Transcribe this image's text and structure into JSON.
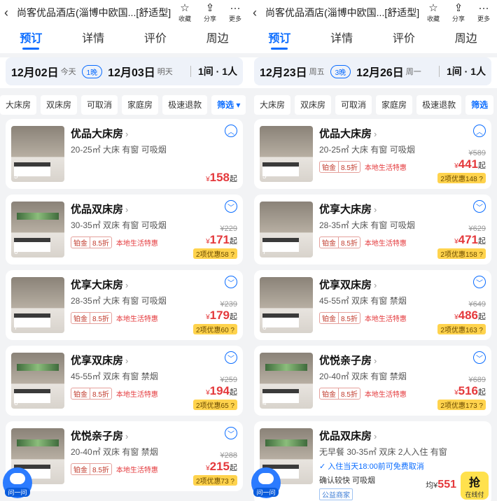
{
  "panels": [
    {
      "title": "尚客优品酒店(淄博中欧国...[舒适型]",
      "actions": [
        {
          "icon": "star-icon",
          "label": "收藏"
        },
        {
          "icon": "share-icon",
          "label": "分享"
        },
        {
          "icon": "more-icon",
          "label": "更多"
        }
      ],
      "tabs": [
        "预订",
        "详情",
        "评价",
        "周边"
      ],
      "dates": {
        "in": "12月02日",
        "in_sub": "今天",
        "nights": "1晚",
        "out": "12月03日",
        "out_sub": "明天",
        "rooms": "1间 · 1人"
      },
      "filters": [
        "大床房",
        "双床房",
        "可取消",
        "家庭房",
        "极速退款",
        "筛选 ▾"
      ],
      "rooms": [
        {
          "name": "优品大床房",
          "spec": "20-25㎡ 大床 有窗 可吸烟",
          "count": "5",
          "orig": "",
          "price": "158",
          "suffix": "起",
          "platinum": "",
          "discount": "",
          "local": "",
          "promo": "",
          "expanded": true
        },
        {
          "name": "优品双床房",
          "spec": "30-35㎡ 双床 有窗 可吸烟",
          "count": "6",
          "orig": "¥229",
          "price": "171",
          "suffix": "起",
          "platinum": "铂金",
          "discount": "8.5折",
          "local": "本地生活特惠",
          "promo": "2项优惠58 ?"
        },
        {
          "name": "优享大床房",
          "spec": "28-35㎡ 大床 有窗 可吸烟",
          "count": "7",
          "orig": "¥239",
          "price": "179",
          "suffix": "起",
          "platinum": "铂金",
          "discount": "8.5折",
          "local": "本地生活特惠",
          "promo": "2项优惠60 ?"
        },
        {
          "name": "优享双床房",
          "spec": "45-55㎡ 双床 有窗 禁烟",
          "count": "6",
          "orig": "¥259",
          "price": "194",
          "suffix": "起",
          "platinum": "铂金",
          "discount": "8.5折",
          "local": "本地生活特惠",
          "promo": "2项优惠65 ?"
        },
        {
          "name": "优悦亲子房",
          "spec": "20-40㎡ 双床 有窗 禁烟",
          "count": "",
          "orig": "¥288",
          "price": "215",
          "suffix": "起",
          "platinum": "铂金",
          "discount": "8.5折",
          "local": "本地生活特惠",
          "promo": "2项优惠73 ?"
        }
      ],
      "bot_label": "问一问"
    },
    {
      "title": "尚客优品酒店(淄博中欧国...[舒适型]",
      "actions": [
        {
          "icon": "star-icon",
          "label": "收藏"
        },
        {
          "icon": "share-icon",
          "label": "分享"
        },
        {
          "icon": "more-icon",
          "label": "更多"
        }
      ],
      "tabs": [
        "预订",
        "详情",
        "评价",
        "周边"
      ],
      "dates": {
        "in": "12月23日",
        "in_sub": "周五",
        "nights": "3晚",
        "out": "12月26日",
        "out_sub": "周一",
        "rooms": "1间 · 1人"
      },
      "filters": [
        "大床房",
        "双床房",
        "可取消",
        "家庭房",
        "极速退款",
        "筛选"
      ],
      "rooms": [
        {
          "name": "优品大床房",
          "spec": "20-25㎡ 大床 有窗 可吸烟",
          "count": "5",
          "orig": "¥589",
          "price": "441",
          "suffix": "起",
          "platinum": "铂金",
          "discount": "8.5折",
          "local": "本地生活特惠",
          "promo": "2项优惠148 ?"
        },
        {
          "name": "优享大床房",
          "spec": "28-35㎡ 大床 有窗 可吸烟",
          "count": "7",
          "orig": "¥629",
          "price": "471",
          "suffix": "起",
          "platinum": "铂金",
          "discount": "8.5折",
          "local": "本地生活特惠",
          "promo": "2项优惠158 ?"
        },
        {
          "name": "优享双床房",
          "spec": "45-55㎡ 双床 有窗 禁烟",
          "count": "6",
          "orig": "¥649",
          "price": "486",
          "suffix": "起",
          "platinum": "铂金",
          "discount": "8.5折",
          "local": "本地生活特惠",
          "promo": "2项优惠163 ?"
        },
        {
          "name": "优悦亲子房",
          "spec": "20-40㎡ 双床 有窗 禁烟",
          "count": "4",
          "orig": "¥689",
          "price": "516",
          "suffix": "起",
          "platinum": "铂金",
          "discount": "8.5折",
          "local": "本地生活特惠",
          "promo": "2项优惠173 ?"
        }
      ],
      "special": {
        "name": "优品双床房",
        "spec": "无早餐 30-35㎡ 双床 2人入住 有窗",
        "cancel": "入住当天18:00前可免费取消",
        "extras": "确认较快  可吸烟",
        "merchant": "公益商家",
        "avg_label": "均¥",
        "avg_price": "551",
        "grab": "抢",
        "grab_sub": "在线付"
      },
      "bot_label": "问一问"
    }
  ],
  "colors": {
    "accent": "#0a6cff",
    "price": "#e4393c",
    "promo": "#ffd34d"
  }
}
